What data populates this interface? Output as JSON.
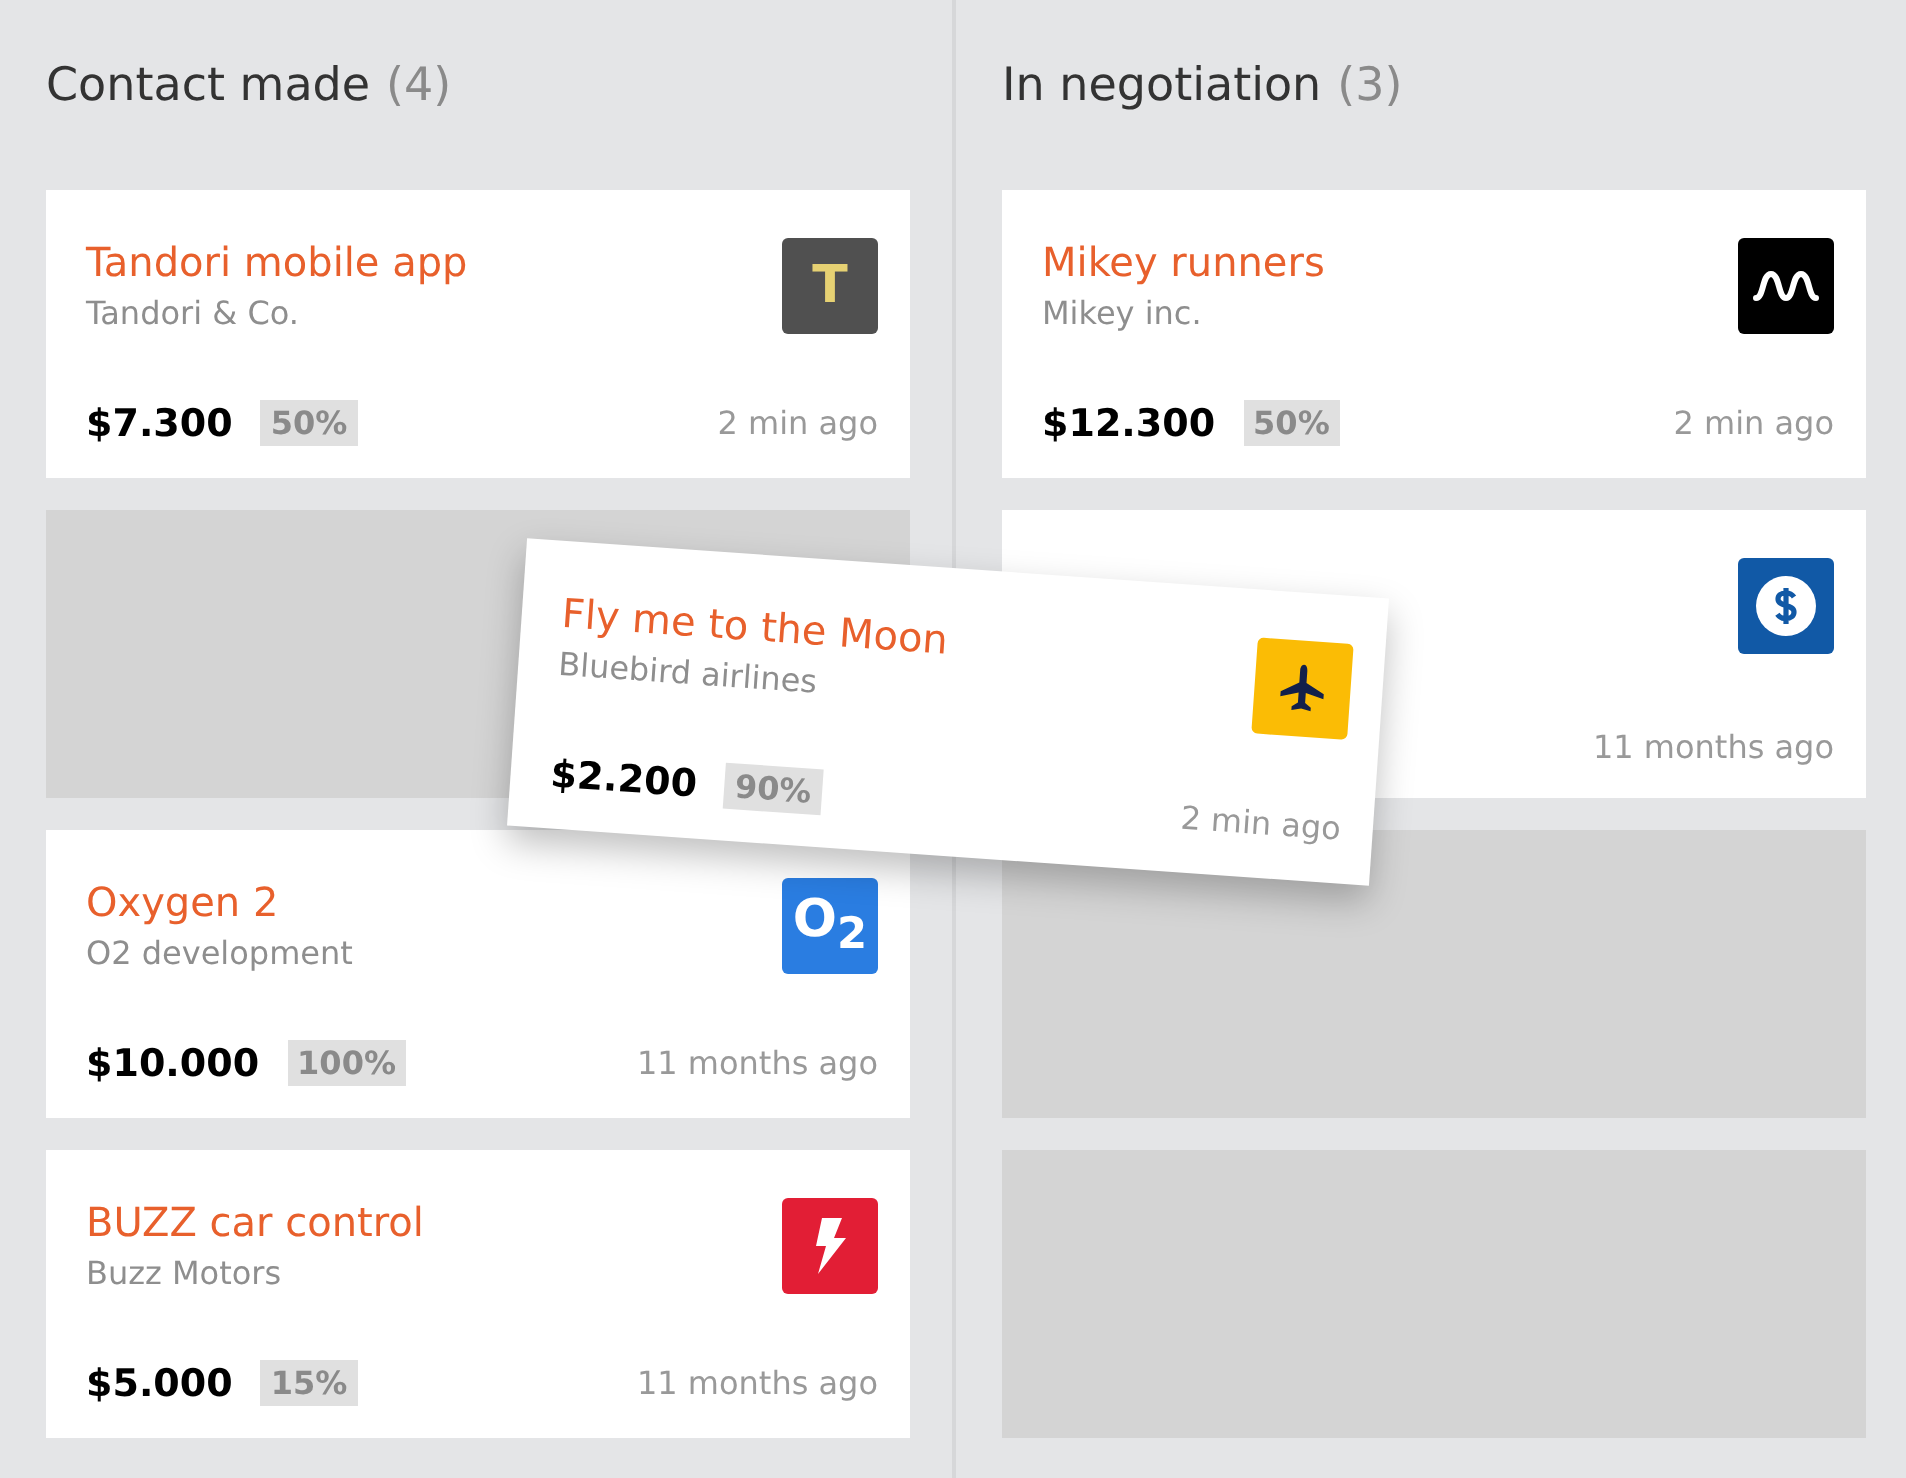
{
  "columns": [
    {
      "title": "Contact made",
      "count": "(4)",
      "slots": [
        {
          "kind": "card",
          "title": "Tandori mobile app",
          "company": "Tandori & Co.",
          "amount": "$7.300",
          "probability": "50%",
          "time": "2 min ago",
          "logo": {
            "kind": "letter",
            "text": "T",
            "color": "#505050"
          }
        },
        {
          "kind": "placeholder"
        },
        {
          "kind": "card",
          "title": "Oxygen 2",
          "company": "O2 development",
          "amount": "$10.000",
          "probability": "100%",
          "time": "11 months ago",
          "logo": {
            "kind": "letter",
            "text": "O$_{2}$",
            "color": "#2a7de1"
          }
        },
        {
          "kind": "card",
          "title": "BUZZ car control",
          "company": "Buzz Motors",
          "amount": "$5.000",
          "probability": "15%",
          "time": "11 months ago",
          "logo": {
            "kind": "lightning",
            "color": "#e21e35"
          }
        }
      ]
    },
    {
      "title": "In negotiation",
      "count": "(3)",
      "slots": [
        {
          "kind": "card",
          "title": "Mikey runners",
          "company": "Mikey inc.",
          "amount": "$12.300",
          "probability": "50%",
          "time": "2 min ago",
          "logo": {
            "kind": "wave",
            "color": "#000000"
          }
        },
        {
          "kind": "card",
          "time": "11 months ago",
          "logo": {
            "kind": "dollar",
            "color": "#1159a6"
          }
        },
        {
          "kind": "placeholder"
        },
        {
          "kind": "placeholder"
        }
      ]
    }
  ],
  "dragged": {
    "title": "Fly me to the Moon",
    "company": "Bluebird airlines",
    "amount": "$2.200",
    "probability": "90%",
    "time": "2 min ago",
    "logo": {
      "kind": "plane",
      "color": "#fbbc05"
    }
  }
}
